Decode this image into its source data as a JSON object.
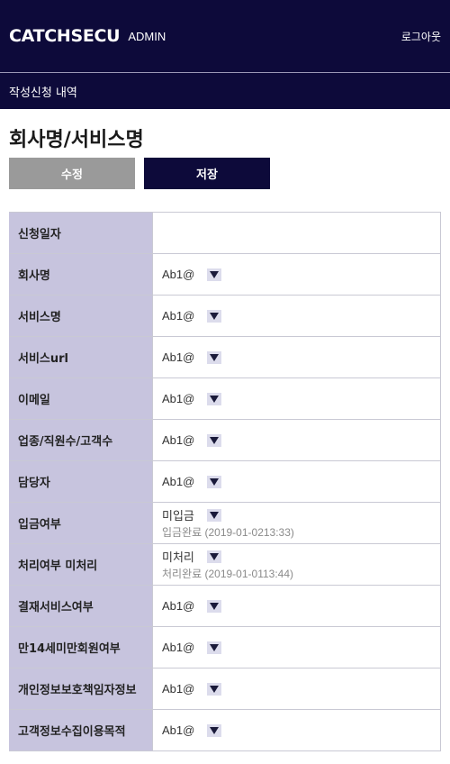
{
  "header": {
    "logo": "CATCHSECU",
    "admin": "ADMIN",
    "logout": "로그아웃"
  },
  "subnav": {
    "label": "작성신청 내역"
  },
  "page": {
    "title": "회사명/서비스명"
  },
  "actions": {
    "edit": "수정",
    "save": "저장"
  },
  "form": {
    "rows": [
      {
        "label": "신청일자",
        "value": ""
      },
      {
        "label": "회사명",
        "value": "Ab1@"
      },
      {
        "label": "서비스명",
        "value": "Ab1@"
      },
      {
        "label": "서비스url",
        "value": "Ab1@"
      },
      {
        "label": "이메일",
        "value": "Ab1@"
      },
      {
        "label": "업종/직원수/고객수",
        "value": "Ab1@"
      },
      {
        "label": "담당자",
        "value": "Ab1@"
      },
      {
        "label": "입금여부",
        "value": "미입금",
        "sub": "입금완료 (2019-01-0213:33)"
      },
      {
        "label": "처리여부 미처리",
        "value": "미처리",
        "sub": "처리완료 (2019-01-0113:44)"
      },
      {
        "label": "결재서비스여부",
        "value": "Ab1@"
      },
      {
        "label": "만14세미만회원여부",
        "value": "Ab1@"
      },
      {
        "label": "개인정보보호책임자정보",
        "value": "Ab1@"
      },
      {
        "label": "고객정보수집이용목적",
        "value": "Ab1@"
      }
    ]
  },
  "icons": {
    "dropdown": "triangle-down-icon"
  },
  "colors": {
    "primary": "#0d0a3a",
    "label_bg": "#c7c4de",
    "edit_btn": "#9a9a9a"
  }
}
